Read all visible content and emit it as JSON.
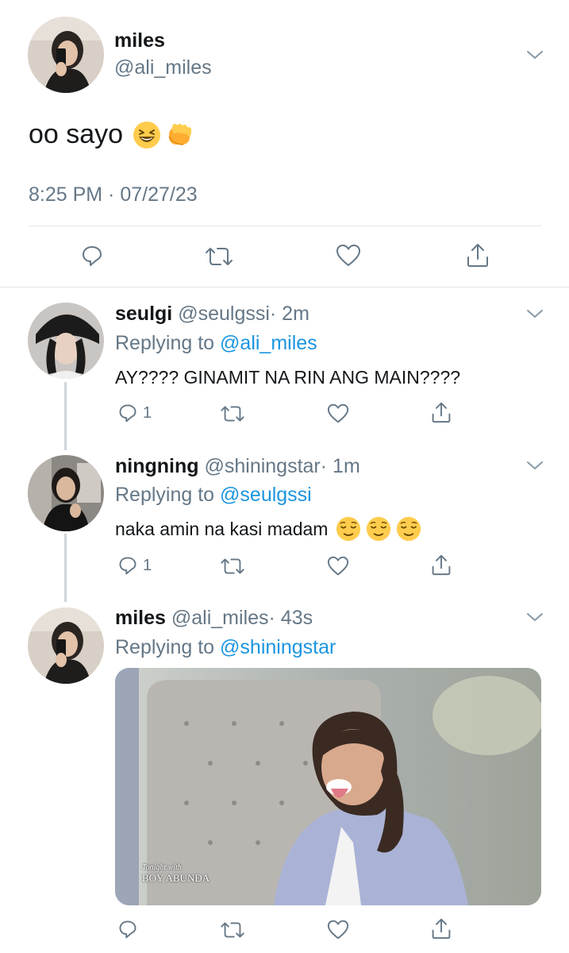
{
  "main_tweet": {
    "display_name": "miles",
    "handle": "@ali_miles",
    "text": "oo sayo",
    "text_emojis": [
      "laughing-face",
      "fist-bump"
    ],
    "timestamp": "8:25 PM · 07/27/23",
    "actions": [
      "reply-icon",
      "retweet-icon",
      "like-icon",
      "share-icon"
    ]
  },
  "replies": [
    {
      "display_name": "seulgi",
      "handle": "@seulgssi",
      "age": "· 2m",
      "replying_prefix": "Replying to ",
      "replying_to": "@ali_miles",
      "text": "AY???? GINAMIT NA RIN ANG MAIN????",
      "reply_count": "1"
    },
    {
      "display_name": "ningning",
      "handle": "@shiningstar",
      "age": "· 1m",
      "replying_prefix": "Replying to ",
      "replying_to": "@seulgssi",
      "text": "naka amin na kasi madam",
      "text_emojis": [
        "relieved-face",
        "relieved-face",
        "relieved-face"
      ],
      "reply_count": "1"
    },
    {
      "display_name": "miles",
      "handle": "@ali_miles",
      "age": "· 43s",
      "replying_prefix": "Replying to ",
      "replying_to": "@shiningstar",
      "media": {
        "caption_small": "Tonight with",
        "caption_large": "BOY ABUNDA"
      }
    }
  ],
  "colors": {
    "text_primary": "#14171a",
    "text_secondary": "#657786",
    "mention_blue": "#1b95e0",
    "divider": "#e1e8ed",
    "thread_line": "#ccd6dd"
  }
}
